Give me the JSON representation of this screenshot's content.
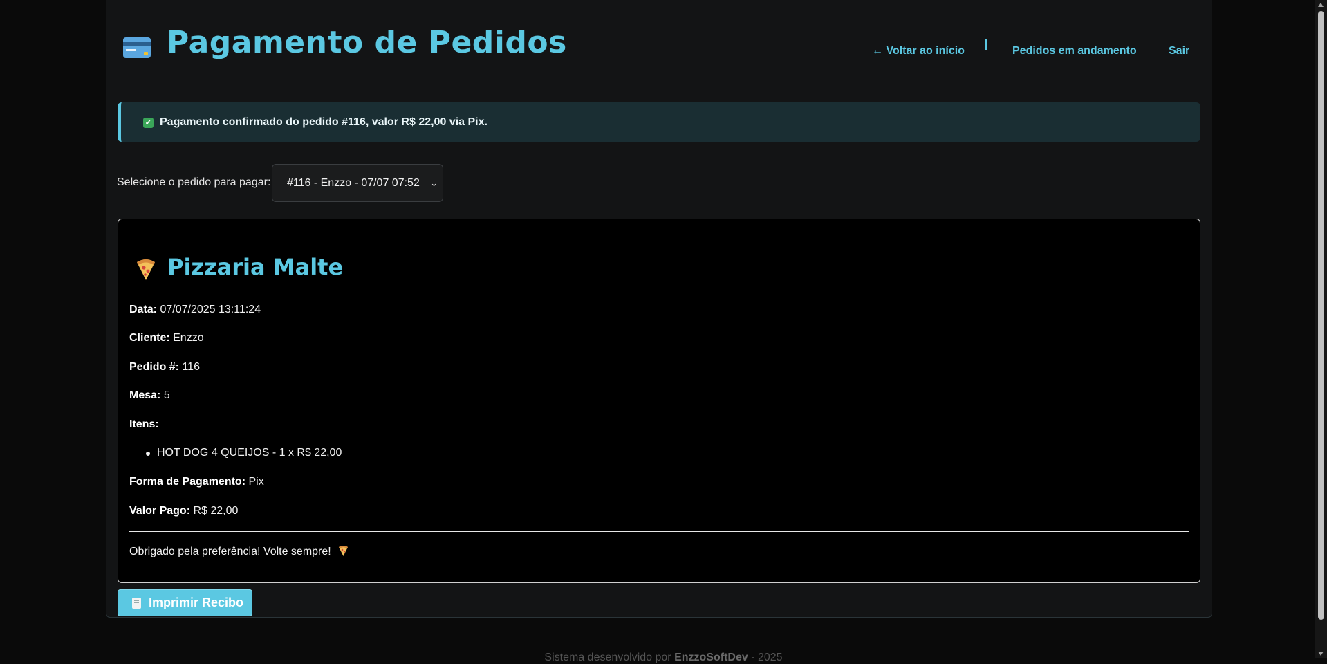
{
  "header": {
    "title": "Pagamento de Pedidos",
    "icon": "credit-card-icon"
  },
  "nav": {
    "back": "← Voltar ao início",
    "orders": "Pedidos em andamento",
    "logout": "Sair"
  },
  "alert": {
    "text_before": "Pagamento confirmado do pedido #116, valor R$ 22,00 via ",
    "method": "Pix",
    "text_after": ".",
    "icon": "check-icon"
  },
  "order_select": {
    "label": "Selecione o pedido para pagar:",
    "selected": "#116 - Enzzo - 07/07 07:52"
  },
  "receipt": {
    "title": "Pizzaria Malte",
    "icon": "pizza-icon",
    "date_label": "Data:",
    "date_value": "07/07/2025 13:11:24",
    "client_label": "Cliente:",
    "client_value": "Enzzo",
    "order_label": "Pedido #:",
    "order_value": "116",
    "table_label": "Mesa:",
    "table_value": "5",
    "items_label": "Itens:",
    "items": [
      "HOT DOG 4 QUEIJOS - 1 x R$ 22,00"
    ],
    "payment_label": "Forma de Pagamento:",
    "payment_value": "Pix",
    "paid_label": "Valor Pago:",
    "paid_value": "R$ 22,00",
    "thanks": "Obrigado pela preferência! Volte sempre!"
  },
  "print_button": {
    "label": "Imprimir Recibo",
    "icon": "receipt-icon"
  },
  "footer": {
    "text_before": "Sistema desenvolvido por ",
    "brand": "EnzzoSoftDev",
    "text_after": " - 2025"
  },
  "colors": {
    "accent": "#5bc8e2",
    "background": "#0a0a0a",
    "card": "#131415",
    "alert_bg": "#1a2e33"
  }
}
